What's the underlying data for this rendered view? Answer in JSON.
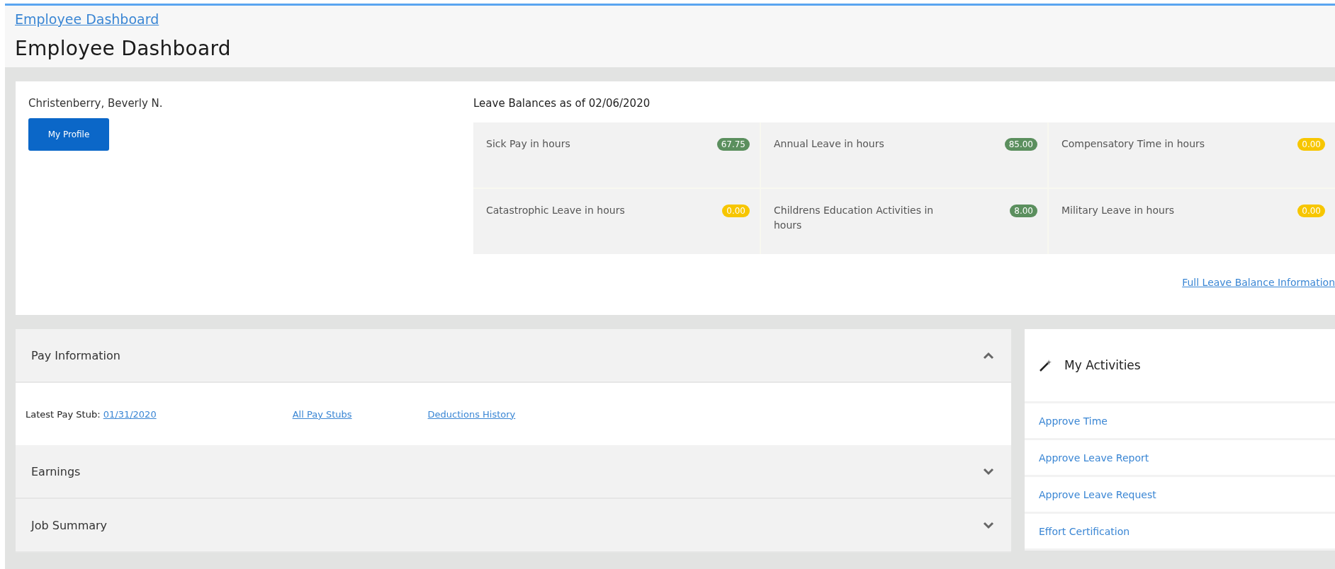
{
  "breadcrumb": "Employee Dashboard",
  "title": "Employee Dashboard",
  "profile": {
    "name": "Christenberry, Beverly N.",
    "button": "My Profile"
  },
  "leave_balances": {
    "title": "Leave Balances as of 02/06/2020",
    "items": [
      {
        "label": "Sick Pay in hours",
        "value": "67.75",
        "color": "#5b8f5e"
      },
      {
        "label": "Annual Leave in hours",
        "value": "85.00",
        "color": "#5b8f5e"
      },
      {
        "label": "Compensatory Time in hours",
        "value": "0.00",
        "color": "#f7c600"
      },
      {
        "label": "Catastrophic Leave in hours",
        "value": "0.00",
        "color": "#f7c600"
      },
      {
        "label": "Childrens Education Activities in hours",
        "value": "8.00",
        "color": "#5b8f5e"
      },
      {
        "label": "Military Leave in hours",
        "value": "0.00",
        "color": "#f7c600"
      }
    ],
    "link": "Full Leave Balance Information"
  },
  "sections": [
    {
      "title": "Pay Information",
      "expanded": true,
      "content": {
        "label": "Latest Pay Stub:",
        "stub_link": "01/31/2020",
        "links": [
          "All Pay Stubs",
          "Deductions History"
        ]
      }
    },
    {
      "title": "Earnings",
      "expanded": false
    },
    {
      "title": "Job Summary",
      "expanded": false
    }
  ],
  "activities": {
    "title": "My Activities",
    "items": [
      "Approve Time",
      "Approve Leave Report",
      "Approve Leave Request",
      "Effort Certification"
    ]
  }
}
